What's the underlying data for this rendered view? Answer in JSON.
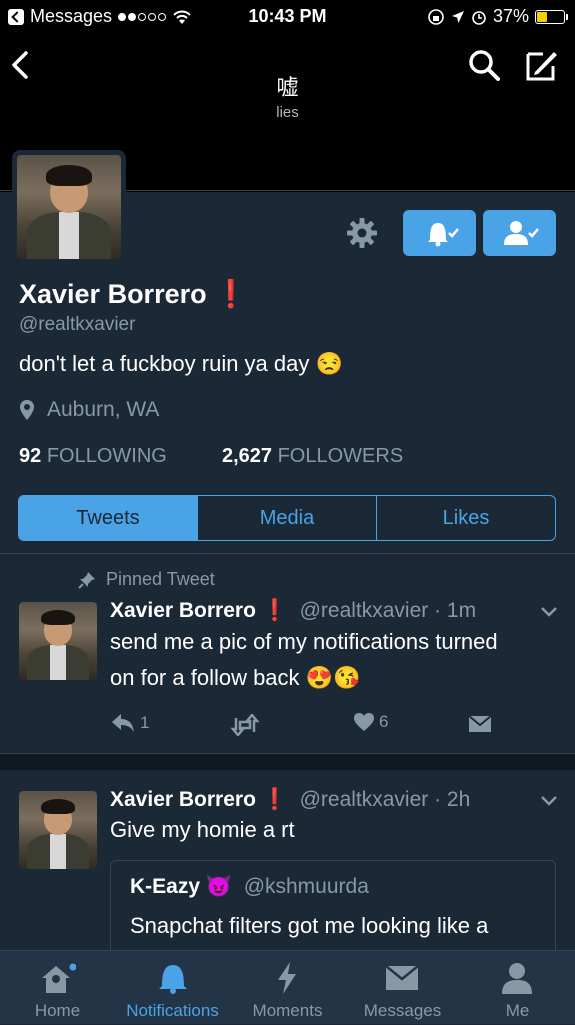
{
  "status_bar": {
    "carrier": "Messages",
    "time": "10:43 PM",
    "battery": "37%",
    "battery_level": 0.37
  },
  "header": {
    "title": "嘘",
    "subtitle": "lies"
  },
  "profile": {
    "name": "Xavier Borrero",
    "badge": "❗",
    "handle": "@realtkxavier",
    "bio": "don't let a fuckboy ruin ya day 😒",
    "location": "Auburn, WA",
    "following_count": "92",
    "following_label": "FOLLOWING",
    "followers_count": "2,627",
    "followers_label": "FOLLOWERS"
  },
  "tabs": [
    "Tweets",
    "Media",
    "Likes"
  ],
  "pinned_label": "Pinned Tweet",
  "tweets": [
    {
      "name": "Xavier Borrero",
      "badge": "❗",
      "handle_time": "@realtkxavier · 1m",
      "text_line1": "send me a pic of my notifications turned",
      "text_line2": "on for a follow back 😍😘",
      "replies": "1",
      "likes": "6"
    },
    {
      "name": "Xavier Borrero",
      "badge": "❗",
      "handle_time": "@realtkxavier · 2h",
      "text": "Give my homie a rt",
      "quote": {
        "name": "K-Eazy 😈",
        "handle": "@kshmuurda",
        "text": "Snapchat filters got me looking like a"
      }
    }
  ],
  "tab_bar": [
    "Home",
    "Notifications",
    "Moments",
    "Messages",
    "Me"
  ],
  "colors": {
    "accent": "#4aa3e6",
    "background": "#1b2836",
    "muted": "#8899a6",
    "alert": "#e0245e"
  }
}
